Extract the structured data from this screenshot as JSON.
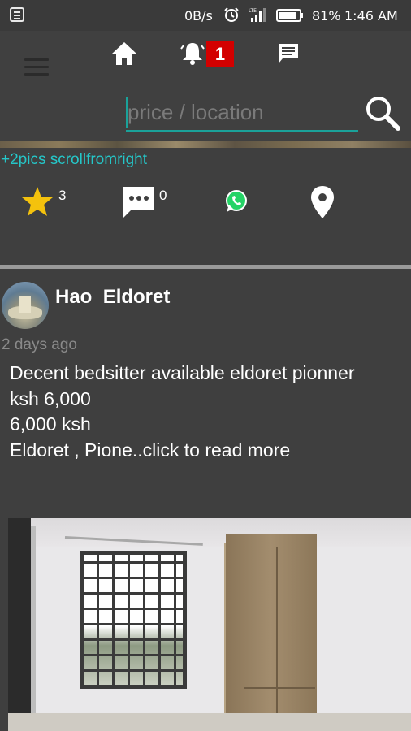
{
  "status_bar": {
    "speed": "0B/s",
    "battery_percent": "81%",
    "time": "1:46 AM"
  },
  "app_bar": {
    "notification_count": "1",
    "search_placeholder": "price / location"
  },
  "listing": {
    "scroll_hint": "+2pics scrollfromright",
    "star_count": "3",
    "comment_count": "0"
  },
  "post": {
    "username": "Hao_Eldoret",
    "time_ago": "2 days ago",
    "lines": [
      "Decent bedsitter available eldoret pionner",
      "ksh 6,000",
      "6,000 ksh",
      "Eldoret , Pione..click to read more"
    ]
  },
  "colors": {
    "background": "#3f3f3f",
    "accent_teal": "#1aa29a",
    "hint_cyan": "#25c6c8",
    "badge_red": "#d30000",
    "star_yellow": "#f4c20d",
    "whatsapp_green": "#25d366"
  },
  "icons": [
    "notification-icon",
    "alarm-icon",
    "signal-icon",
    "battery-icon",
    "menu-icon",
    "home-icon",
    "bell-icon",
    "chat-icon",
    "search-icon",
    "star-icon",
    "comment-icon",
    "whatsapp-icon",
    "location-icon"
  ]
}
